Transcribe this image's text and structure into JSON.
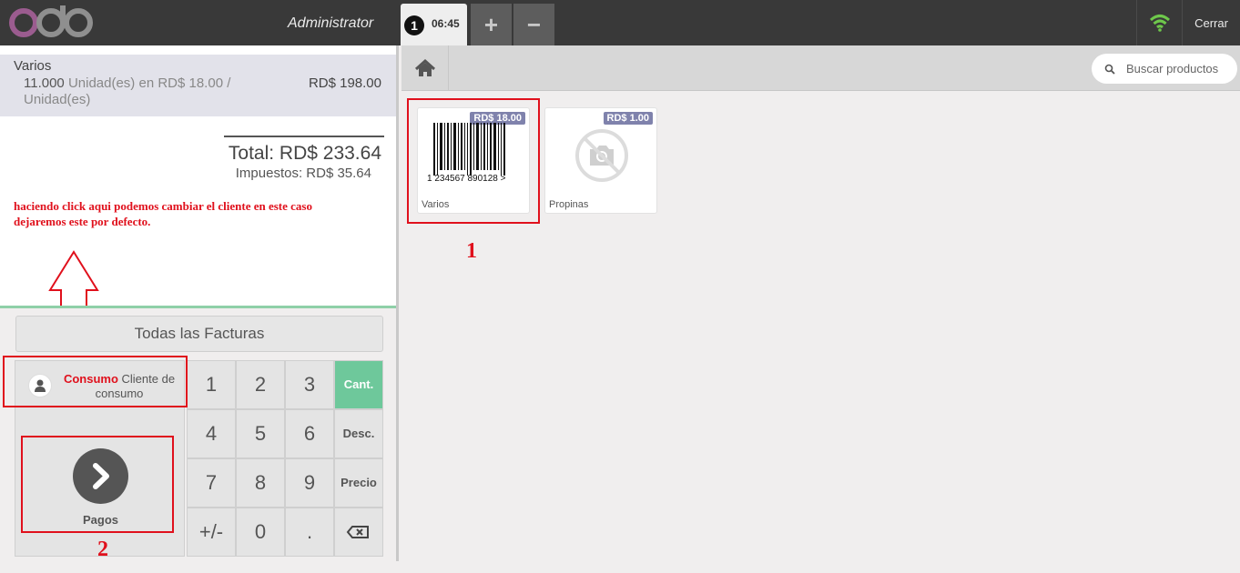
{
  "header": {
    "logo_text": "odoo",
    "user": "Administrator",
    "order_tab": {
      "number": "1",
      "time": "06:45"
    },
    "add_tab_label": "+",
    "remove_tab_label": "−",
    "close_label": "Cerrar"
  },
  "order": {
    "line": {
      "name": "Varios",
      "qty": "11.000",
      "unit_text": "Unidad(es) en RD$ 18.00 / Unidad(es)",
      "price": "RD$ 198.00"
    },
    "total": "Total: RD$ 233.64",
    "taxes": "Impuestos: RD$ 35.64"
  },
  "annotation": {
    "note": "haciendo click aqui podemos cambiar el cliente en este caso dejaremos este por defecto.",
    "marker_1": "1",
    "marker_2": "2"
  },
  "control": {
    "invoices_button": "Todas las Facturas",
    "customer_highlight": "Consumo",
    "customer_rest": "Cliente de consumo",
    "pay_label": "Pagos"
  },
  "numpad": {
    "keys": [
      "1",
      "2",
      "3",
      "4",
      "5",
      "6",
      "7",
      "8",
      "9",
      "+/-",
      "0",
      "."
    ],
    "modes": [
      "Cant.",
      "Desc.",
      "Precio"
    ],
    "backspace_icon": "backspace-icon"
  },
  "products": {
    "search_placeholder": "Buscar productos",
    "items": [
      {
        "name": "Varios",
        "price": "RD$ 18.00",
        "barcode_text": "1 234567 890128 >"
      },
      {
        "name": "Propinas",
        "price": "RD$ 1.00"
      }
    ]
  },
  "colors": {
    "topbar": "#393939",
    "accent_green": "#6ec89b",
    "price_tag": "#7f82ac",
    "annotation_red": "#e0101c"
  }
}
